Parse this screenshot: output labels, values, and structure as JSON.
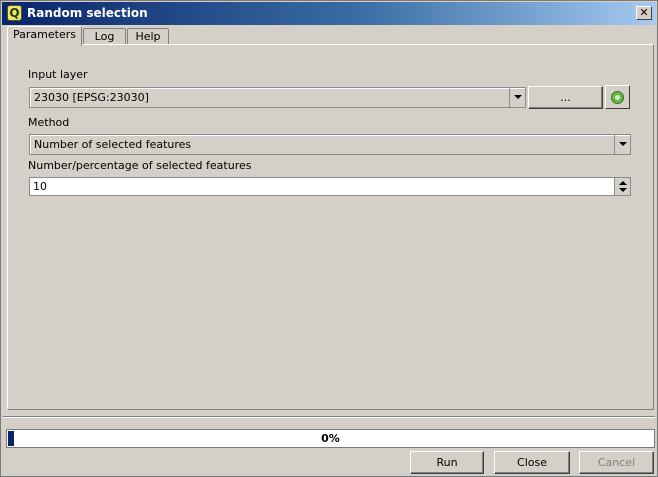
{
  "window": {
    "title": "Random selection",
    "app_icon_glyph": "Q",
    "close_glyph": "✕"
  },
  "tabs": [
    {
      "label": "Parameters",
      "active": true
    },
    {
      "label": "Log",
      "active": false
    },
    {
      "label": "Help",
      "active": false
    }
  ],
  "params": {
    "input_layer_label": "Input layer",
    "input_layer_value": "23030 [EPSG:23030]",
    "browse_label": "...",
    "method_label": "Method",
    "method_value": "Number of selected features",
    "number_label": "Number/percentage of selected features",
    "number_value": "10"
  },
  "progress": {
    "value": 0.01,
    "text": "0%"
  },
  "buttons": {
    "run": "Run",
    "close": "Close",
    "cancel": "Cancel"
  },
  "colors": {
    "titlebar_start": "#0a246a",
    "titlebar_end": "#a6caf0",
    "progress_fill": "#0a246a",
    "refresh_icon": "#68b845"
  }
}
